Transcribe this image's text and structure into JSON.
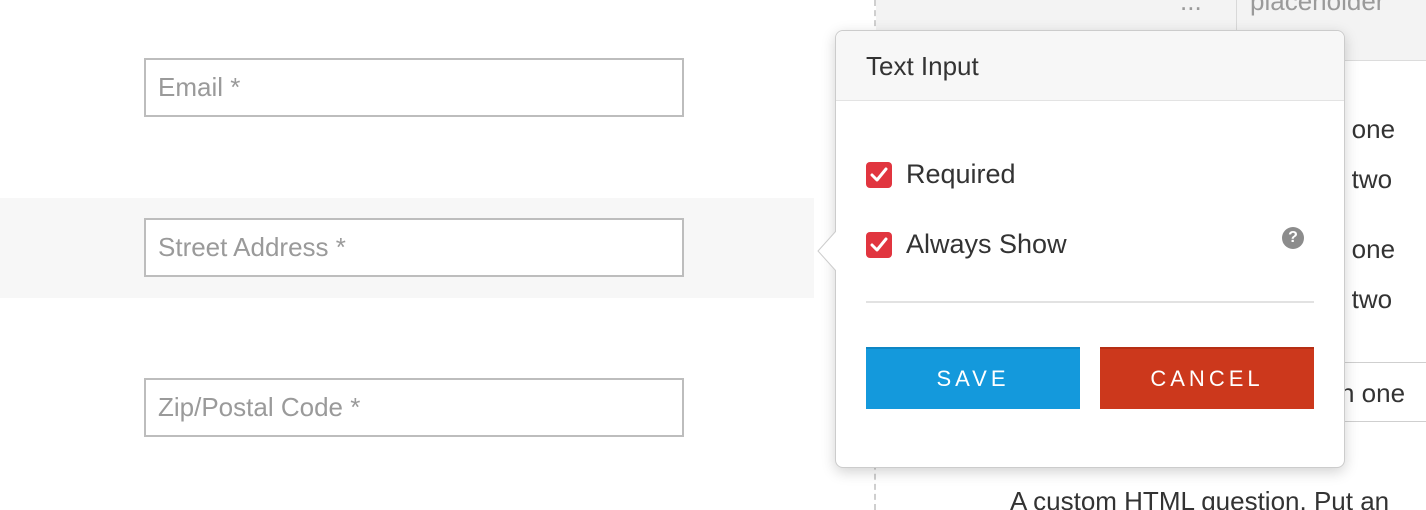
{
  "form": {
    "email_placeholder": "Email *",
    "street_placeholder": "Street Address *",
    "zip_placeholder": "Zip/Postal Code *"
  },
  "right_panel": {
    "placeholder_text": "placeholder",
    "ellipsis": "...",
    "options": [
      "n one",
      "n two",
      "n one",
      "n two",
      "n one"
    ],
    "custom_html_text": "A custom HTML question. Put an"
  },
  "popover": {
    "title": "Text Input",
    "required_label": "Required",
    "always_show_label": "Always Show",
    "help_icon": "question-circle-icon",
    "required_checked": true,
    "always_show_checked": true,
    "save_label": "SAVE",
    "cancel_label": "CANCEL"
  },
  "colors": {
    "checkbox": "#e1353f",
    "save_button": "#1499dc",
    "cancel_button": "#cc381c"
  }
}
